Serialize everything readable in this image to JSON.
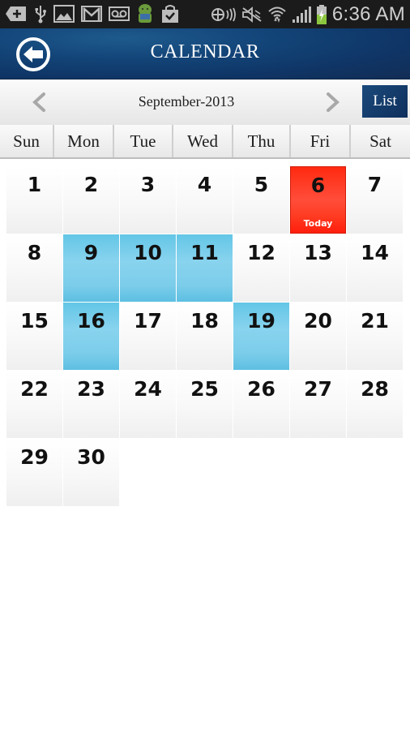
{
  "status_bar": {
    "time": "6:36 AM",
    "icons": [
      "add-notification-icon",
      "usb-icon",
      "gallery-icon",
      "gmail-icon",
      "voicemail-icon",
      "android-icon",
      "shopping-bag-check-icon",
      "nfc-icon",
      "mute-icon",
      "wifi-icon",
      "signal-icon",
      "battery-charging-icon"
    ]
  },
  "header": {
    "title": "CALENDAR",
    "back_icon": "back-arrow-circle-icon"
  },
  "month_nav": {
    "label": "September-2013",
    "prev_icon": "chevron-left-icon",
    "next_icon": "chevron-right-icon",
    "list_button": "List"
  },
  "weekdays": [
    "Sun",
    "Mon",
    "Tue",
    "Wed",
    "Thu",
    "Fri",
    "Sat"
  ],
  "calendar": {
    "month": "September",
    "year": 2013,
    "first_weekday_index": 0,
    "days_in_month": 30,
    "today": 6,
    "today_label": "Today",
    "event_days": [
      9,
      10,
      11,
      16,
      19
    ],
    "colors": {
      "today": "#ff3b22",
      "event": "#7ccdea",
      "header": "#134579"
    }
  }
}
